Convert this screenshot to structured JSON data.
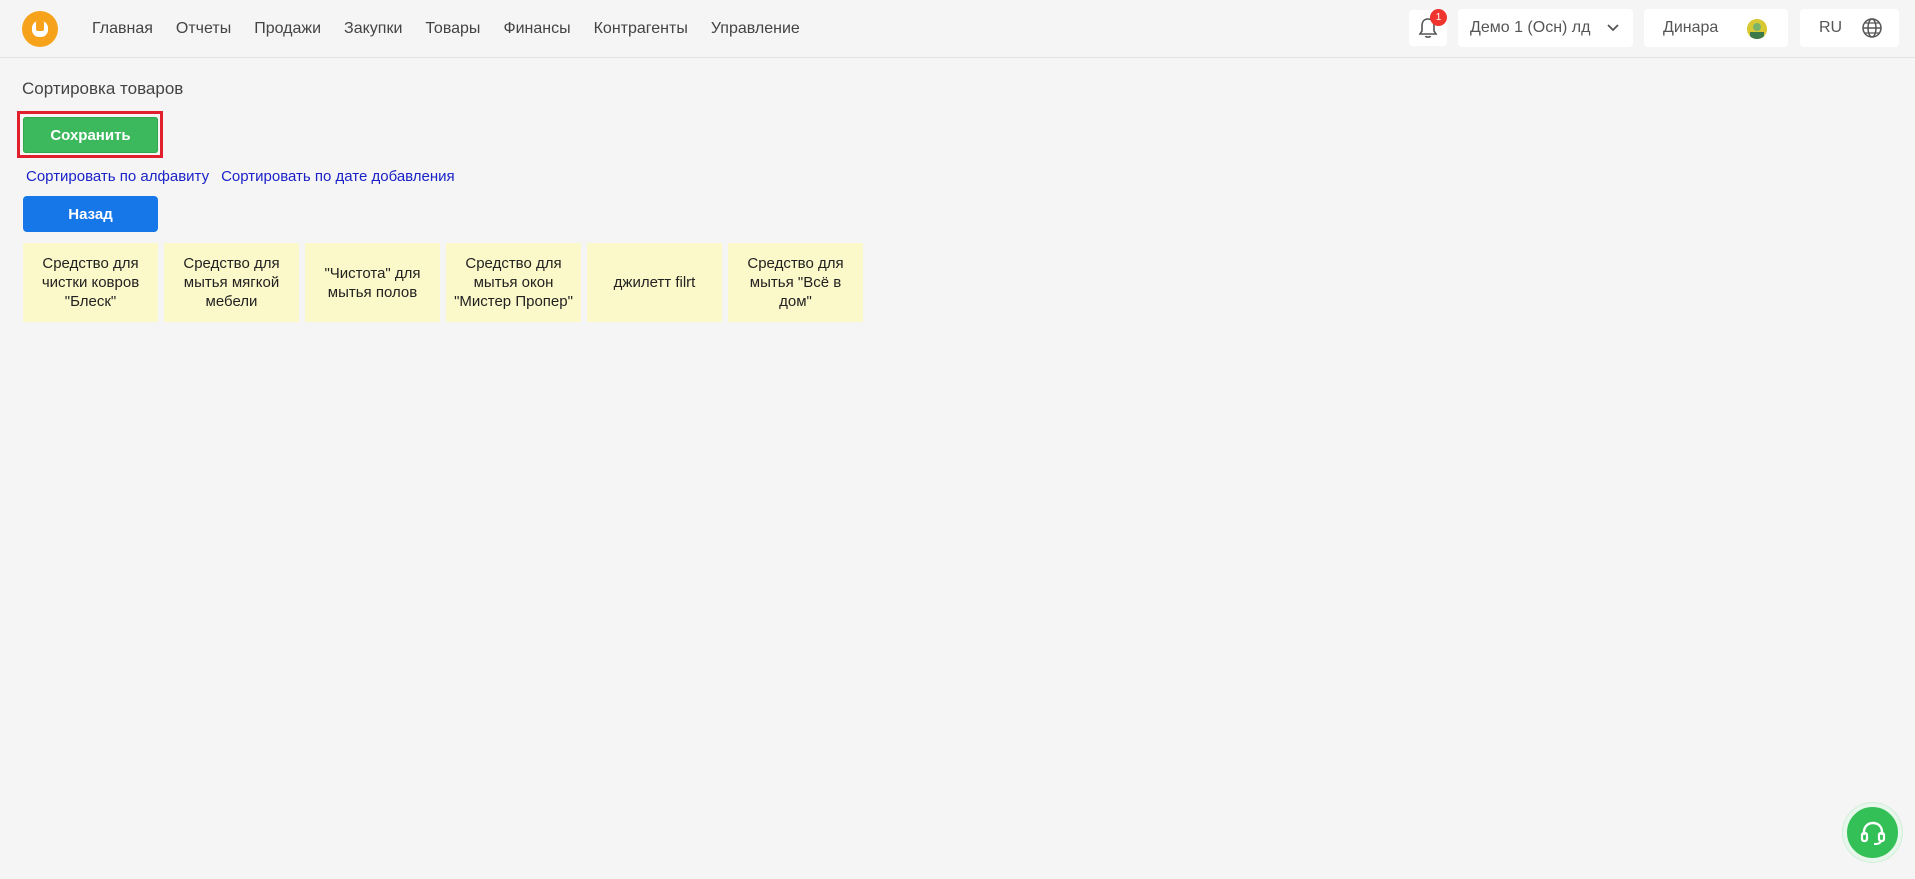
{
  "header": {
    "logo_letter": "U",
    "nav": [
      "Главная",
      "Отчеты",
      "Продажи",
      "Закупки",
      "Товары",
      "Финансы",
      "Контрагенты",
      "Управление"
    ],
    "notifications_count": "1",
    "company": "Демо 1 (Осн) лд",
    "user_name": "Динара",
    "language": "RU"
  },
  "page": {
    "title": "Сортировка товаров",
    "save_label": "Сохранить",
    "sort_alpha_label": "Сортировать по алфавиту",
    "sort_date_label": "Сортировать по дате добавления",
    "back_label": "Назад"
  },
  "products": [
    "Средство для чистки ковров \"Блеск\"",
    "Средство для мытья мягкой мебели",
    "\"Чистота\" для мытья полов",
    "Средство для мытья окон \"Мистер Пропер\"",
    "джилетт filrt",
    "Средство для мытья \"Всё в дом\""
  ],
  "colors": {
    "accent_green": "#3cb95c",
    "accent_blue": "#1577e8",
    "card_bg": "#fbf9c9",
    "logo_orange": "#f7a21b",
    "highlight_red": "#e0202c"
  },
  "icons": {
    "bell": "bell-icon",
    "chevron": "chevron-down-icon",
    "globe": "globe-icon",
    "support": "headset-icon"
  }
}
